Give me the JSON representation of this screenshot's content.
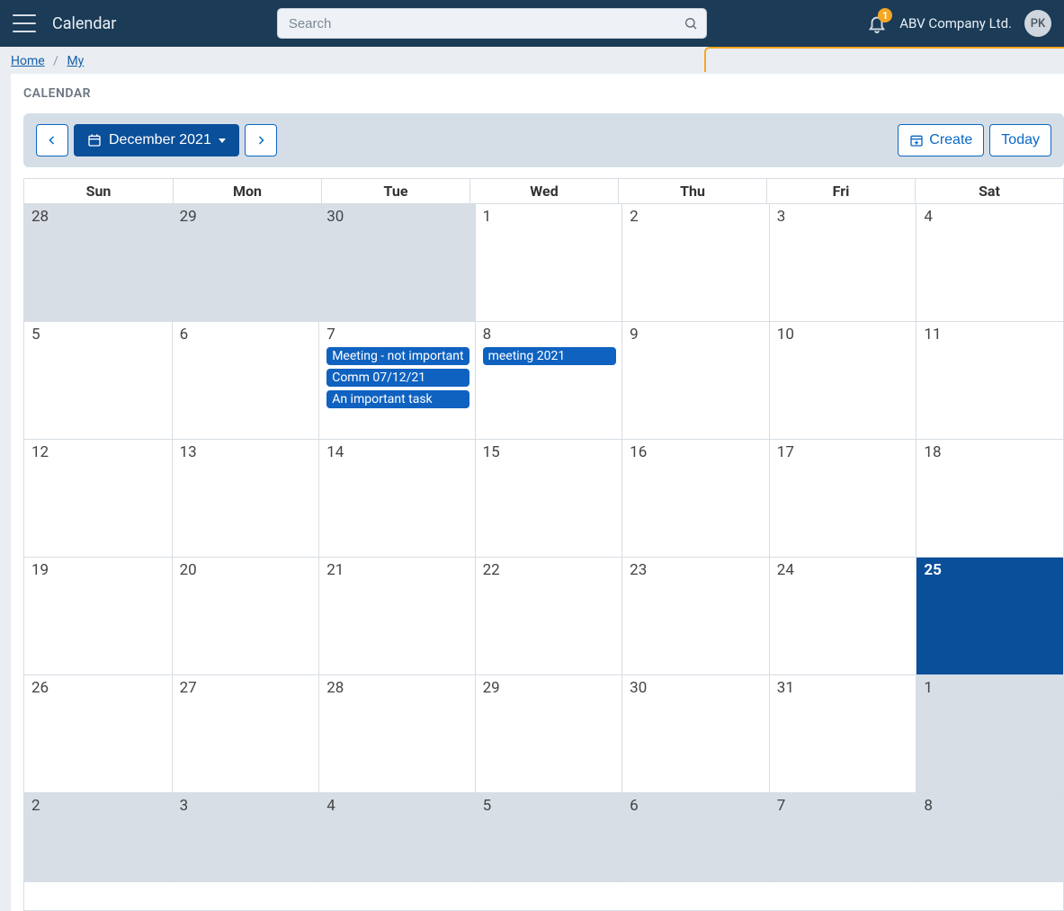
{
  "header": {
    "app_title": "Calendar",
    "search_placeholder": "Search",
    "notification_count": "1",
    "company": "ABV Company Ltd.",
    "avatar_initials": "PK"
  },
  "breadcrumb": {
    "home": "Home",
    "current": "My"
  },
  "page": {
    "label": "CALENDAR"
  },
  "toolbar": {
    "period_label": "December 2021",
    "create_label": "Create",
    "today_label": "Today"
  },
  "calendar": {
    "day_headers": [
      "Sun",
      "Mon",
      "Tue",
      "Wed",
      "Thu",
      "Fri",
      "Sat"
    ],
    "weeks": [
      [
        {
          "num": "28",
          "faded": true
        },
        {
          "num": "29",
          "faded": true
        },
        {
          "num": "30",
          "faded": true
        },
        {
          "num": "1"
        },
        {
          "num": "2"
        },
        {
          "num": "3"
        },
        {
          "num": "4"
        }
      ],
      [
        {
          "num": "5"
        },
        {
          "num": "6"
        },
        {
          "num": "7",
          "events": [
            "Meeting - not important",
            "Comm 07/12/21",
            "An important task"
          ]
        },
        {
          "num": "8",
          "events": [
            "meeting 2021"
          ]
        },
        {
          "num": "9"
        },
        {
          "num": "10"
        },
        {
          "num": "11"
        }
      ],
      [
        {
          "num": "12"
        },
        {
          "num": "13"
        },
        {
          "num": "14"
        },
        {
          "num": "15"
        },
        {
          "num": "16"
        },
        {
          "num": "17"
        },
        {
          "num": "18"
        }
      ],
      [
        {
          "num": "19"
        },
        {
          "num": "20"
        },
        {
          "num": "21"
        },
        {
          "num": "22"
        },
        {
          "num": "23"
        },
        {
          "num": "24"
        },
        {
          "num": "25",
          "today": true
        }
      ],
      [
        {
          "num": "26"
        },
        {
          "num": "27"
        },
        {
          "num": "28"
        },
        {
          "num": "29"
        },
        {
          "num": "30"
        },
        {
          "num": "31"
        },
        {
          "num": "1",
          "faded": true
        }
      ],
      [
        {
          "num": "2",
          "faded": true
        },
        {
          "num": "3",
          "faded": true
        },
        {
          "num": "4",
          "faded": true
        },
        {
          "num": "5",
          "faded": true
        },
        {
          "num": "6",
          "faded": true
        },
        {
          "num": "7",
          "faded": true
        },
        {
          "num": "8",
          "faded": true
        }
      ]
    ]
  }
}
